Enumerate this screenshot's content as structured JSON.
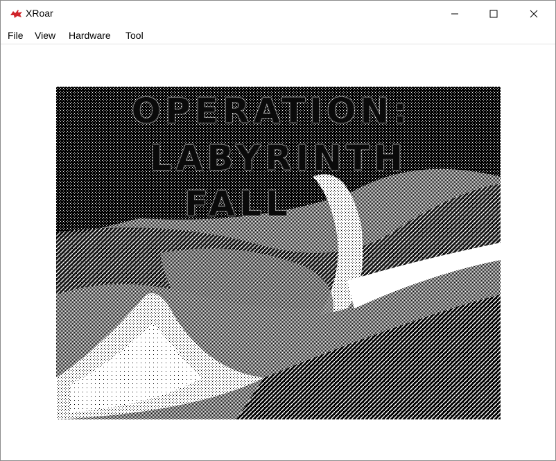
{
  "window": {
    "title": "XRoar"
  },
  "menu": {
    "items": [
      "File",
      "View",
      "Hardware",
      "Tool"
    ]
  },
  "game_screen": {
    "title_lines": [
      "OPERATION:",
      "LABYRINTH",
      "FALL"
    ]
  },
  "icons": {
    "app": "dragon-icon",
    "minimize": "minimize-icon",
    "maximize": "maximize-icon",
    "close": "close-icon"
  }
}
